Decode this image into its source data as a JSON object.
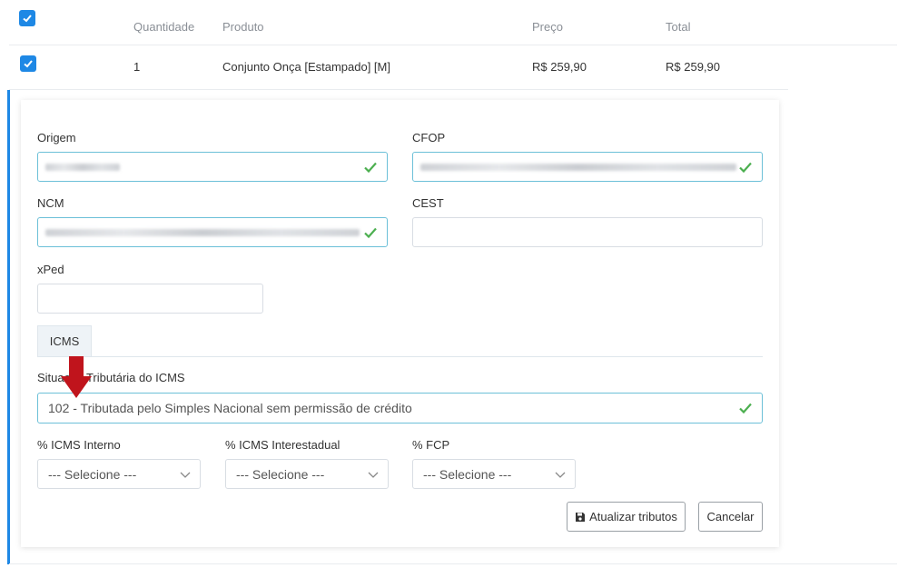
{
  "table": {
    "headers": {
      "quantidade": "Quantidade",
      "produto": "Produto",
      "preco": "Preço",
      "total": "Total"
    },
    "row": {
      "quantidade": "1",
      "produto": "Conjunto Onça [Estampado] [M]",
      "preco": "R$ 259,90",
      "total": "R$ 259,90"
    }
  },
  "form": {
    "origem_label": "Origem",
    "cfop_label": "CFOP",
    "ncm_label": "NCM",
    "cest_label": "CEST",
    "xped_label": "xPed",
    "tab_icms": "ICMS",
    "situacao_label": "Situação Tributária do ICMS",
    "situacao_value": "102 - Tributada pelo Simples Nacional sem permissão de crédito",
    "icms_interno_label": "% ICMS Interno",
    "icms_interestadual_label": "% ICMS Interestadual",
    "fcp_label": "% FCP",
    "select_placeholder": "--- Selecione ---",
    "btn_atualizar": "Atualizar tributos",
    "btn_cancelar": "Cancelar"
  },
  "icons": {
    "checkbox": "check-icon",
    "valid": "checkmark-icon",
    "chevron": "chevron-down-icon",
    "save": "floppy-disk-icon",
    "annotation": "red-arrow-down"
  },
  "colors": {
    "accent": "#1e88e5",
    "valid_green": "#4caf50",
    "valid_border": "#6cc0d8",
    "arrow_red": "#c0141c"
  }
}
